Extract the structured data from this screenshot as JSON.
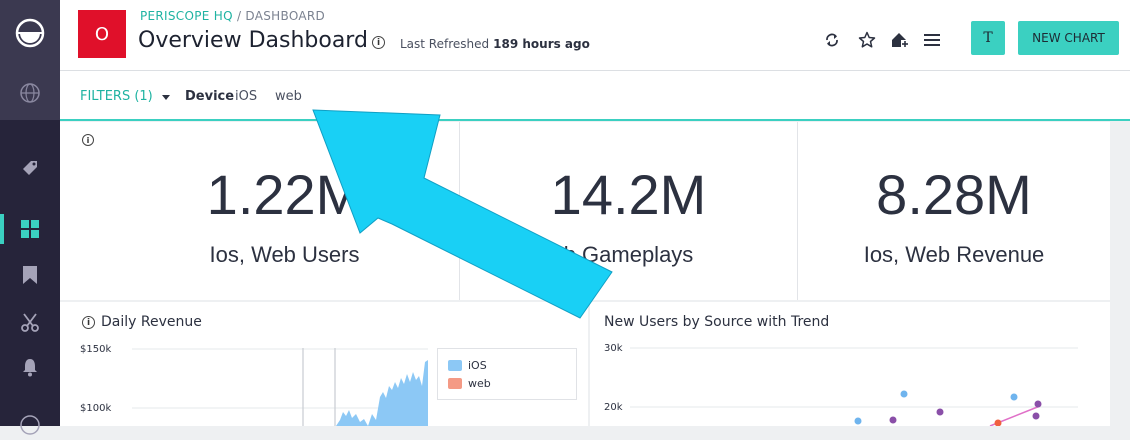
{
  "sidebar": {
    "items": [
      "logo-icon",
      "globe-icon",
      "tag-icon",
      "dashboard-icon",
      "bookmark-icon",
      "scissors-icon",
      "bell-icon"
    ]
  },
  "header": {
    "logo_letter": "O",
    "org": "PERISCOPE HQ",
    "crumb_sep": " / ",
    "crumb_page": "DASHBOARD",
    "title": "Overview Dashboard",
    "refresh_label": "Last Refreshed",
    "refresh_value": "189 hours ago",
    "user_initial": "T",
    "new_chart_label": "NEW CHART"
  },
  "filters": {
    "label": "FILTERS (1)",
    "field": "Device",
    "values": [
      "iOS",
      "web"
    ]
  },
  "kpis": [
    {
      "value": "1.22M",
      "label": "Ios, Web Users"
    },
    {
      "value": "14.2M",
      "label": "b Gameplays"
    },
    {
      "value": "8.28M",
      "label": "Ios, Web Revenue"
    }
  ],
  "charts": {
    "revenue": {
      "title": "Daily Revenue",
      "y_ticks": [
        "$150k",
        "$100k"
      ],
      "legend": [
        {
          "name": "iOS",
          "color": "#8cc8f5"
        },
        {
          "name": "web",
          "color": "#f49a85"
        }
      ]
    },
    "users": {
      "title": "New Users by Source with Trend",
      "y_ticks": [
        "30k",
        "20k"
      ]
    }
  },
  "colors": {
    "accent": "#3bd0c1",
    "brand_red": "#e0102a",
    "sidebar": "#26243a",
    "arrow": "#19d0f5"
  }
}
